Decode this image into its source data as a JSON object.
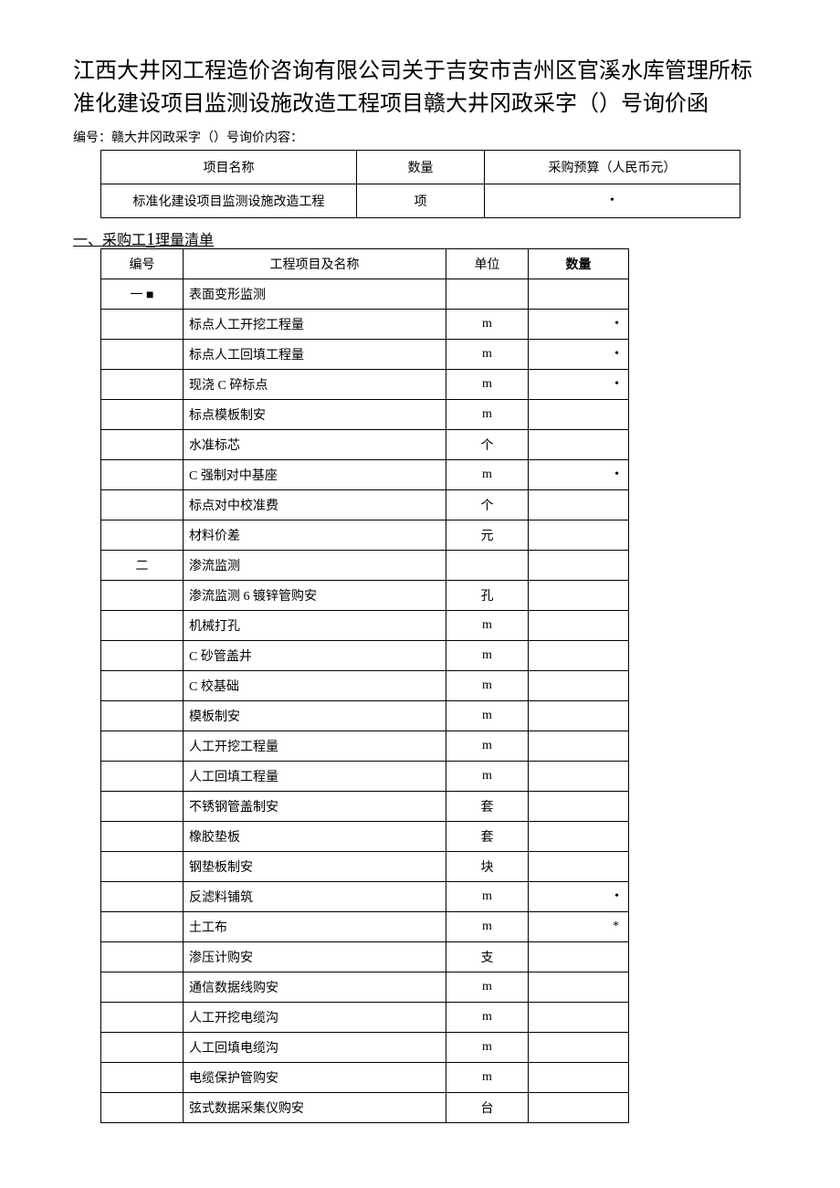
{
  "title": "江西大井冈工程造价咨询有限公司关于吉安市吉州区官溪水库管理所标准化建设项目监测设施改造工程项目赣大井冈政采字（）号询价函",
  "subheader": "编号：赣大井冈政采字（）号询价内容：",
  "table1": {
    "headers": {
      "c1": "项目名称",
      "c2": "数量",
      "c3": "采购预算（人民币元）"
    },
    "row": {
      "c1": "标准化建设项目监测设施改造工程",
      "c2": "项",
      "c3": "•"
    }
  },
  "section_prefix": "一、采购工",
  "section_big": "1",
  "section_suffix": "理量清单",
  "table2": {
    "headers": {
      "a": "编号",
      "b": "工程项目及名称",
      "c": "单位",
      "d": "数量"
    },
    "rows": [
      {
        "a": "一 ■",
        "b": "表面变形监测",
        "c": "",
        "d": ""
      },
      {
        "a": "",
        "b": "标点人工开挖工程量",
        "c": "m",
        "d": "•"
      },
      {
        "a": "",
        "b": "标点人工回填工程量",
        "c": "m",
        "d": "•"
      },
      {
        "a": "",
        "b": "现浇 C 碎标点",
        "c": "m",
        "d": "•"
      },
      {
        "a": "",
        "b": "标点模板制安",
        "c": "m",
        "d": ""
      },
      {
        "a": "",
        "b": "水准标芯",
        "c": "个",
        "d": ""
      },
      {
        "a": "",
        "b": "C 强制对中基座",
        "c": "m",
        "d": "•"
      },
      {
        "a": "",
        "b": "标点对中校准费",
        "c": "个",
        "d": ""
      },
      {
        "a": "",
        "b": "材料价差",
        "c": "元",
        "d": ""
      },
      {
        "a": "二",
        "b": "渗流监测",
        "c": "",
        "d": ""
      },
      {
        "a": "",
        "b": "渗流监测 6 镀锌管购安",
        "c": "孔",
        "d": ""
      },
      {
        "a": "",
        "b": "机械打孔",
        "c": "m",
        "d": ""
      },
      {
        "a": "",
        "b": "C 砂管盖井",
        "c": "m",
        "d": ""
      },
      {
        "a": "",
        "b": "C 校基础",
        "c": "m",
        "d": ""
      },
      {
        "a": "",
        "b": "模板制安",
        "c": "m",
        "d": ""
      },
      {
        "a": "",
        "b": "人工开挖工程量",
        "c": "m",
        "d": ""
      },
      {
        "a": "",
        "b": "人工回填工程量",
        "c": "m",
        "d": ""
      },
      {
        "a": "",
        "b": "不锈钢管盖制安",
        "c": "套",
        "d": ""
      },
      {
        "a": "",
        "b": "橡胶垫板",
        "c": "套",
        "d": ""
      },
      {
        "a": "",
        "b": "钢垫板制安",
        "c": "块",
        "d": ""
      },
      {
        "a": "",
        "b": "反滤料铺筑",
        "c": "m",
        "d": "•"
      },
      {
        "a": "",
        "b": "土工布",
        "c": "m",
        "d": "*"
      },
      {
        "a": "",
        "b": "渗压计购安",
        "c": "支",
        "d": ""
      },
      {
        "a": "",
        "b": "通信数据线购安",
        "c": "m",
        "d": ""
      },
      {
        "a": "",
        "b": "人工开挖电缆沟",
        "c": "m",
        "d": ""
      },
      {
        "a": "",
        "b": "人工回填电缆沟",
        "c": "m",
        "d": ""
      },
      {
        "a": "",
        "b": "电缆保护管购安",
        "c": "m",
        "d": ""
      },
      {
        "a": "",
        "b": "弦式数据采集仪购安",
        "c": "台",
        "d": ""
      }
    ]
  }
}
